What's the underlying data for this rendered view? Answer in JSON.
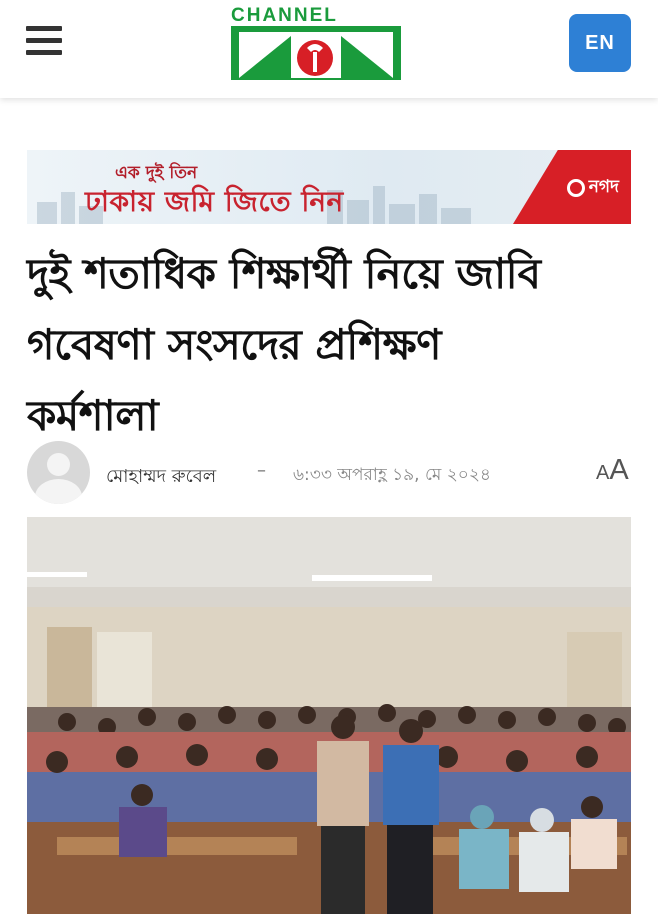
{
  "header": {
    "menu_icon": "hamburger-menu-icon",
    "logo": {
      "word": "CHANNEL",
      "icon": "channel-i-logo"
    },
    "language_button": "EN"
  },
  "ad": {
    "line1": "এক দুই তিন",
    "line2": "ঢাকায় জমি জিতে নিন",
    "brand": "নগদ",
    "colors": {
      "accent": "#d71f26",
      "text": "#c8232f"
    }
  },
  "article": {
    "headline_lines": [
      "দুই শতাধিক শিক্ষার্থী নিয়ে জাবি",
      "গবেষণা সংসদের প্রশিক্ষণ",
      "কর্মশালা"
    ],
    "author": "মোহাম্মদ রুবেল",
    "separator": "–",
    "datetime": "৬:৩৩ অপরাহ্ণ ১৯, মে ২০২৪",
    "font_size_control": {
      "small": "A",
      "large": "A"
    },
    "image": {
      "subject": "group-photo-students-classroom"
    }
  },
  "colors": {
    "lang_button": "#2e80d5",
    "logo_green": "#1a9b3c",
    "logo_red": "#d71f26"
  }
}
